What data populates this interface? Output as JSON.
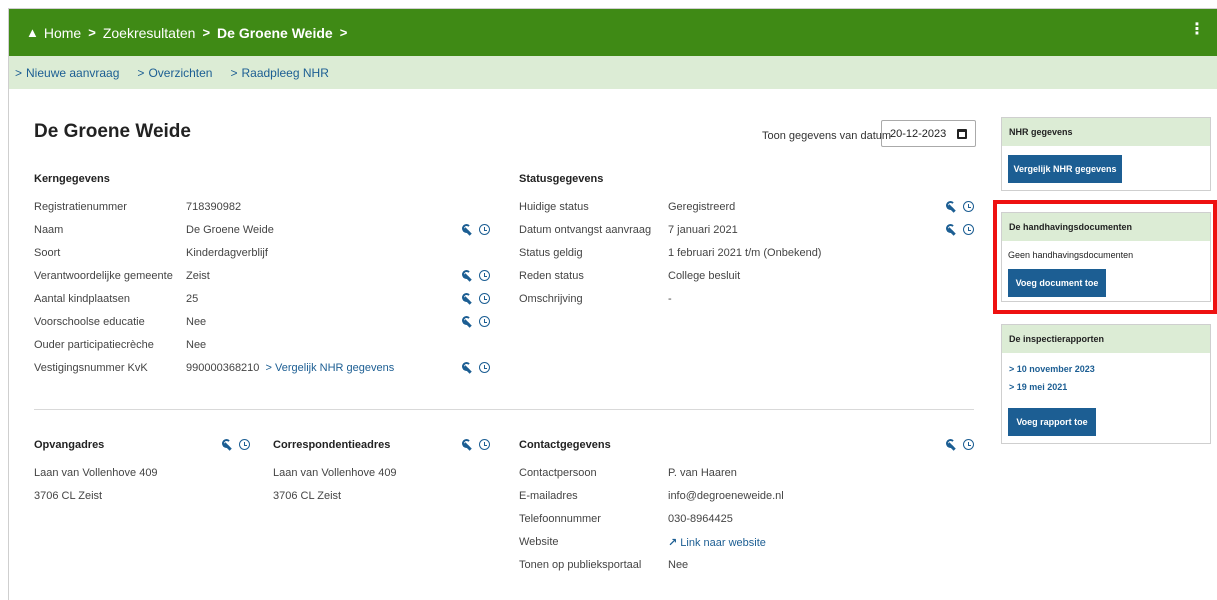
{
  "breadcrumb": {
    "home": "Home",
    "search": "Zoekresultaten",
    "current": "De Groene Weide"
  },
  "subnav": [
    "Nieuwe aanvraag",
    "Overzichten",
    "Raadpleeg NHR"
  ],
  "page": {
    "title": "De Groene Weide",
    "date_label": "Toon gegevens van datum",
    "date_value": "20-12-2023"
  },
  "kerngegevens": {
    "heading": "Kerngegevens",
    "rows": [
      {
        "label": "Registratienummer",
        "value": "718390982"
      },
      {
        "label": "Naam",
        "value": "De Groene Weide"
      },
      {
        "label": "Soort",
        "value": "Kinderdagverblijf"
      },
      {
        "label": "Verantwoordelijke gemeente",
        "value": "Zeist"
      },
      {
        "label": "Aantal kindplaatsen",
        "value": "25"
      },
      {
        "label": "Voorschoolse educatie",
        "value": "Nee"
      },
      {
        "label": "Ouder participatiecrèche",
        "value": "Nee"
      },
      {
        "label": "Vestigingsnummer KvK",
        "value": "990000368210",
        "link": "Vergelijk NHR gegevens"
      }
    ]
  },
  "statusgegevens": {
    "heading": "Statusgegevens",
    "rows": [
      {
        "label": "Huidige status",
        "value": "Geregistreerd"
      },
      {
        "label": "Datum ontvangst aanvraag",
        "value": "7 januari 2021"
      },
      {
        "label": "Status geldig",
        "value": "1 februari 2021 t/m (Onbekend)"
      },
      {
        "label": "Reden status",
        "value": "College besluit"
      },
      {
        "label": "Omschrijving",
        "value": "-"
      }
    ]
  },
  "opvangadres": {
    "heading": "Opvangadres",
    "line1": "Laan van Vollenhove 409",
    "line2": "3706 CL Zeist"
  },
  "correspondentieadres": {
    "heading": "Correspondentieadres",
    "line1": "Laan van Vollenhove 409",
    "line2": "3706 CL Zeist"
  },
  "contactgegevens": {
    "heading": "Contactgegevens",
    "rows": [
      {
        "label": "Contactpersoon",
        "value": "P. van Haaren"
      },
      {
        "label": "E-mailadres",
        "value": "info@degroeneweide.nl"
      },
      {
        "label": "Telefoonnummer",
        "value": "030-8964425"
      },
      {
        "label": "Website",
        "value": "Link naar website"
      },
      {
        "label": "Tonen op publieksportaal",
        "value": "Nee"
      }
    ]
  },
  "panels": {
    "nhr": {
      "title": "NHR gegevens",
      "button": "Vergelijk NHR gegevens"
    },
    "handhaving": {
      "title": "De handhavingsdocumenten",
      "empty": "Geen handhavingsdocumenten",
      "button": "Voeg document toe"
    },
    "inspectie": {
      "title": "De inspectierapporten",
      "links": [
        "10 november 2023",
        "19 mei 2021"
      ],
      "button": "Voeg rapport toe"
    }
  },
  "colors": {
    "header": "#3f8a15",
    "subnav": "#dcecd5",
    "link": "#1c5e93",
    "highlight": "#ee1111"
  }
}
